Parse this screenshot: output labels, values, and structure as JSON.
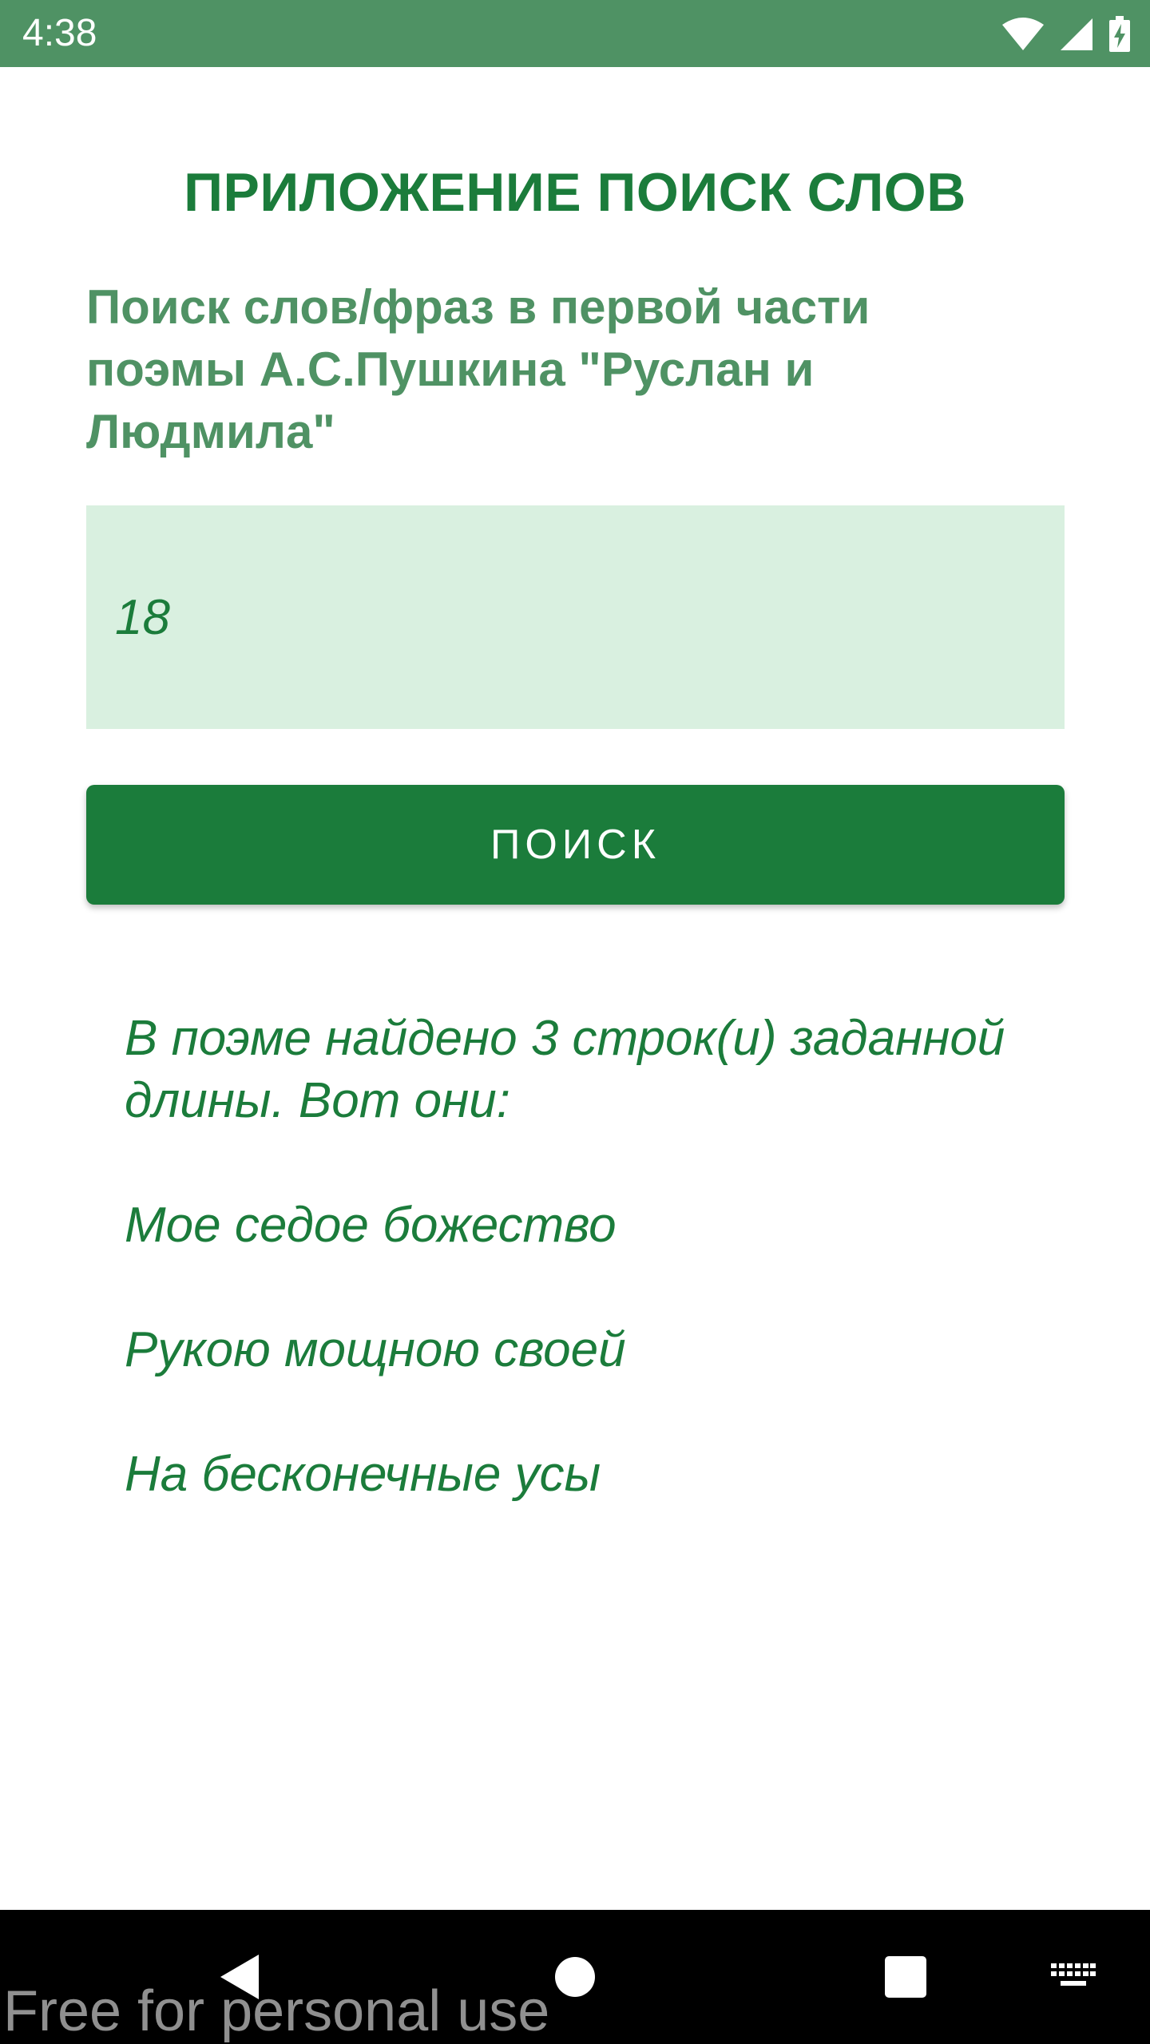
{
  "status_bar": {
    "time": "4:38",
    "icons": [
      "wifi-icon",
      "signal-icon",
      "battery-charging-icon"
    ]
  },
  "app": {
    "title": "ПРИЛОЖЕНИЕ ПОИСК СЛОВ",
    "subtitle": "Поиск слов/фраз в первой части поэмы А.С.Пушкина \"Руслан и Людмила\""
  },
  "search": {
    "value": "18",
    "button_label": "ПОИСК"
  },
  "results": {
    "summary": "В поэме найдено 3 строк(и) заданной длины. Вот они:",
    "lines": [
      "Мое седое божество",
      "Рукою мощною своей",
      "На бесконечные усы"
    ]
  },
  "nav_bar": {
    "icons": [
      "back-icon",
      "home-icon",
      "recents-icon",
      "keyboard-icon"
    ]
  },
  "watermark": "Free for personal use",
  "colors": {
    "status_bar": "#4f9264",
    "primary": "#1b7c3b",
    "subtitle": "#4f9264",
    "input_bg": "#d9f0e0"
  }
}
